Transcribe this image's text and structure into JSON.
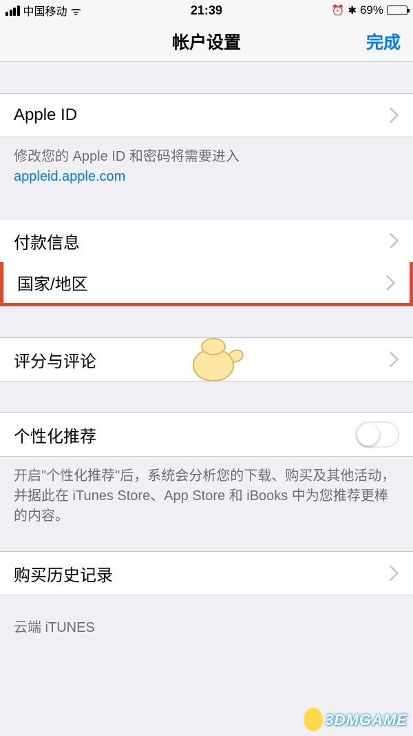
{
  "status": {
    "carrier": "中国移动",
    "time": "21:39",
    "battery_pct": "69%",
    "alarm_glyph": "⏰",
    "bluetooth_glyph": "✱",
    "wifi_glyph": "ᯤ"
  },
  "nav": {
    "title": "帐户设置",
    "done": "完成"
  },
  "cells": {
    "apple_id": "Apple ID",
    "payment": "付款信息",
    "region": "国家/地区",
    "ratings": "评分与评论",
    "personalization": "个性化推荐",
    "purchase_history": "购买历史记录"
  },
  "footers": {
    "appleid_intro": "修改您的 Apple ID 和密码将需要进入",
    "appleid_link": "appleid.apple.com",
    "personalization": "开启\"个性化推荐\"后，系统会分析您的下载、购买及其他活动，并据此在 iTunes Store、App Store 和 iBooks 中为您推荐更棒的内容。"
  },
  "headers": {
    "cloud_itunes": "云端 iTUNES"
  },
  "watermark": "3DMGAME"
}
